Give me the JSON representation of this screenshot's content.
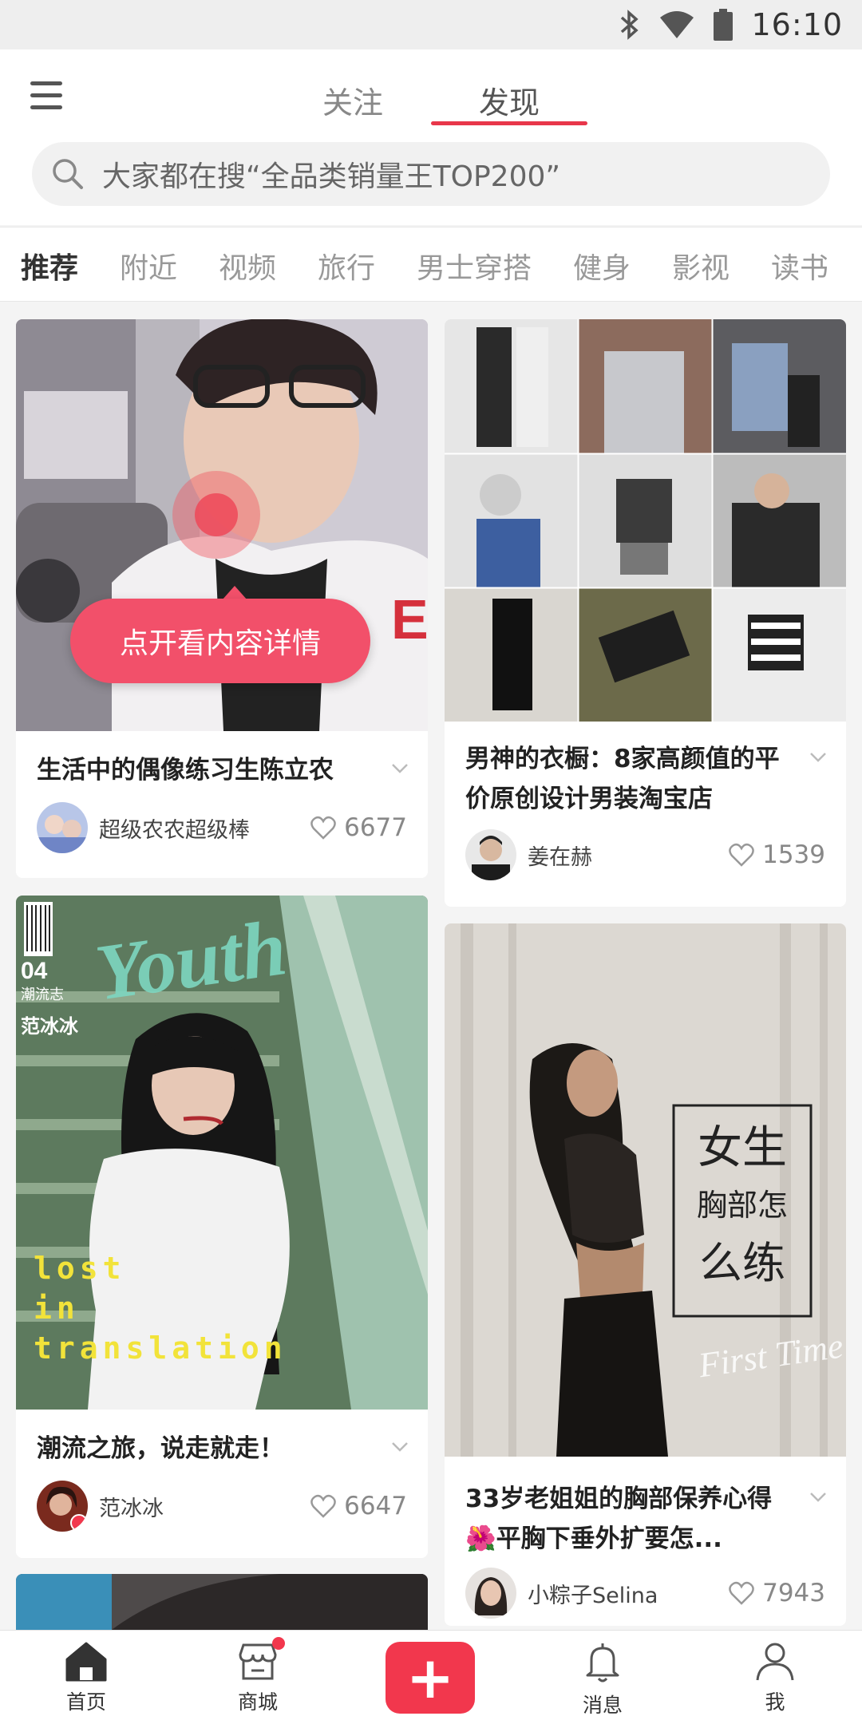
{
  "status_bar": {
    "time": "16:10"
  },
  "header": {
    "tabs": [
      {
        "label": "关注"
      },
      {
        "label": "发现"
      }
    ],
    "search_placeholder": "大家都在搜“全品类销量王TOP200”"
  },
  "categories": [
    {
      "label": "推荐"
    },
    {
      "label": "附近"
    },
    {
      "label": "视频"
    },
    {
      "label": "旅行"
    },
    {
      "label": "男士穿搭"
    },
    {
      "label": "健身"
    },
    {
      "label": "影视"
    },
    {
      "label": "读书"
    }
  ],
  "feed": {
    "overlay_tip": "点开看内容详情",
    "posts": [
      {
        "title": "生活中的偶像练习生陈立农",
        "author": "超级农农超级棒",
        "likes": "6677"
      },
      {
        "title": "男神的衣橱：8家高颜值的平价原创设计男装淘宝店",
        "author": "姜在赫",
        "likes": "1539"
      },
      {
        "title": "潮流之旅，说走就走！",
        "author": "范冰冰",
        "likes": "6647",
        "image_text": {
          "magazine_issue": "04",
          "magazine_sub": "潮流志",
          "cover_name": "范冰冰",
          "script_title": "Youth",
          "lines": [
            "lost",
            "in",
            "translation"
          ]
        }
      },
      {
        "title": "33岁老姐姐的胸部保养心得🌺平胸下垂外扩要怎...",
        "author": "小粽子Selina",
        "likes": "7943",
        "image_text": {
          "box_lines": [
            "女生",
            "胸部怎",
            "么练"
          ],
          "script": "First Time"
        }
      }
    ]
  },
  "bottom_nav": {
    "items": [
      {
        "label": "首页"
      },
      {
        "label": "商城"
      },
      {
        "label": "消息"
      },
      {
        "label": "我"
      }
    ],
    "add_label": "+"
  },
  "colors": {
    "accent": "#f2374d",
    "underline": "#e8364a"
  }
}
